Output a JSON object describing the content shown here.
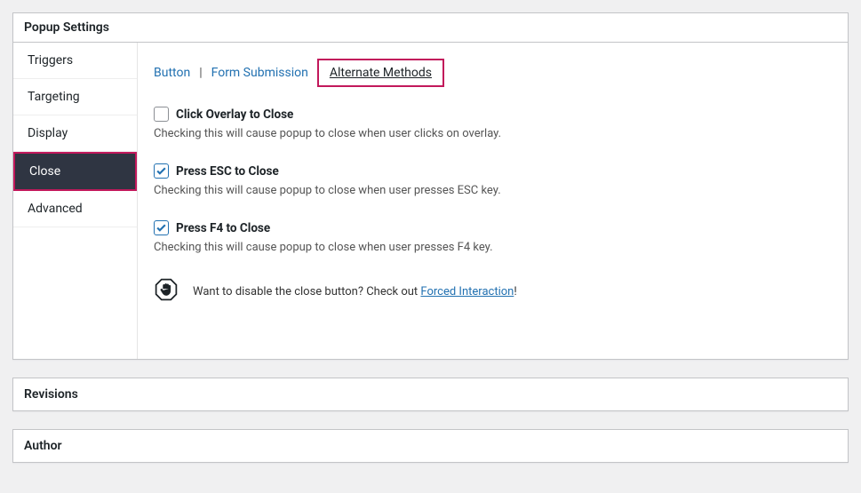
{
  "panel": {
    "title": "Popup Settings"
  },
  "sidebar": {
    "items": [
      {
        "label": "Triggers"
      },
      {
        "label": "Targeting"
      },
      {
        "label": "Display"
      },
      {
        "label": "Close"
      },
      {
        "label": "Advanced"
      }
    ]
  },
  "subtabs": {
    "button": "Button",
    "form": "Form Submission",
    "alt": "Alternate Methods"
  },
  "fields": {
    "overlay": {
      "label": "Click Overlay to Close",
      "desc": "Checking this will cause popup to close when user clicks on overlay."
    },
    "esc": {
      "label": "Press ESC to Close",
      "desc": "Checking this will cause popup to close when user presses ESC key."
    },
    "f4": {
      "label": "Press F4 to Close",
      "desc": "Checking this will cause popup to close when user presses F4 key."
    }
  },
  "note": {
    "prefix": "Want to disable the close button? Check out ",
    "link": "Forced Interaction",
    "suffix": "!"
  },
  "panels": {
    "revisions": "Revisions",
    "author": "Author"
  }
}
